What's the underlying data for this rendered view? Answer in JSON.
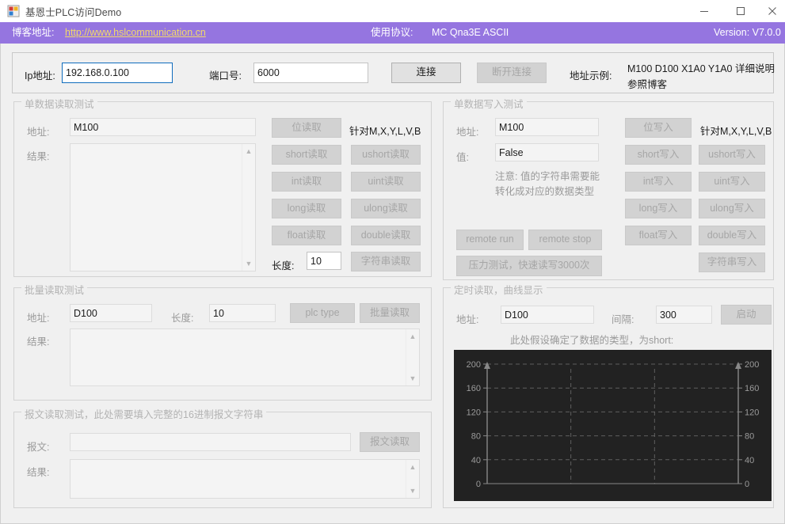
{
  "window": {
    "title": "基恩士PLC访问Demo",
    "app_icon": "window-grid-icon",
    "minimize_label": "—",
    "maximize_label": "□",
    "close_label": "✕"
  },
  "header": {
    "blog_label": "博客地址:",
    "blog_url": "http://www.hslcommunication.cn",
    "protocol_label": "使用协议:",
    "protocol_value": "MC  Qna3E ASCII",
    "version": "Version: V7.0.0",
    "bar_color": "#9575e0",
    "link_color": "#f2d86a"
  },
  "connection": {
    "ip_label": "Ip地址:",
    "ip_value": "192.168.0.100",
    "port_label": "端口号:",
    "port_value": "6000",
    "connect_label": "连接",
    "disconnect_label": "断开连接",
    "example_label": "地址示例:",
    "example_line1": "M100 D100 X1A0 Y1A0 详细说明",
    "example_line2": "参照博客"
  },
  "single_read": {
    "title": "单数据读取测试",
    "address_label": "地址:",
    "address_value": "M100",
    "result_label": "结果:",
    "result_value": "",
    "hint": "针对M,X,Y,L,V,B",
    "length_label": "长度:",
    "length_value": "10",
    "buttons": {
      "bit": "位读取",
      "short": "short读取",
      "ushort": "ushort读取",
      "int": "int读取",
      "uint": "uint读取",
      "long": "long读取",
      "ulong": "ulong读取",
      "float": "float读取",
      "double": "double读取",
      "string": "字符串读取"
    }
  },
  "single_write": {
    "title": "单数据写入测试",
    "address_label": "地址:",
    "address_value": "M100",
    "value_label": "值:",
    "value_value": "False",
    "note_line1": "注意: 值的字符串需要能",
    "note_line2": "转化成对应的数据类型",
    "hint": "针对M,X,Y,L,V,B",
    "buttons": {
      "bit": "位写入",
      "short": "short写入",
      "ushort": "ushort写入",
      "int": "int写入",
      "uint": "uint写入",
      "long": "long写入",
      "ulong": "ulong写入",
      "float": "float写入",
      "double": "double写入",
      "string": "字符串写入",
      "remote_run": "remote run",
      "remote_stop": "remote stop",
      "stress": "压力测试，快速读写3000次"
    }
  },
  "batch_read": {
    "title": "批量读取测试",
    "address_label": "地址:",
    "address_value": "D100",
    "length_label": "长度:",
    "length_value": "10",
    "plc_type_label": "plc type",
    "batch_read_label": "批量读取",
    "result_label": "结果:",
    "result_value": ""
  },
  "message_read": {
    "title": "报文读取测试，此处需要填入完整的16进制报文字符串",
    "message_label": "报文:",
    "message_value": "",
    "read_label": "报文读取",
    "result_label": "结果:",
    "result_value": ""
  },
  "timed_read": {
    "title": "定时读取，曲线显示",
    "address_label": "地址:",
    "address_value": "D100",
    "interval_label": "间隔:",
    "interval_value": "300",
    "start_label": "启动",
    "note": "此处假设确定了数据的类型，为short:"
  },
  "chart_data": {
    "type": "line",
    "title": "",
    "xlabel": "",
    "ylabel": "",
    "series": [
      {
        "name": "short",
        "x": [],
        "values": []
      }
    ],
    "ylim": [
      0,
      200
    ],
    "y_ticks": [
      0,
      40,
      80,
      120,
      160,
      200
    ],
    "y_ticks_right": [
      0,
      40,
      80,
      120,
      160,
      200
    ],
    "grid": true,
    "grid_style": "dashed",
    "vertical_gridlines": 2,
    "background": "#222222",
    "axis_color": "#888888",
    "grid_color": "#6a6a6a",
    "tick_label_color": "#9a9a9a",
    "legend": "none",
    "data_points": 0
  }
}
